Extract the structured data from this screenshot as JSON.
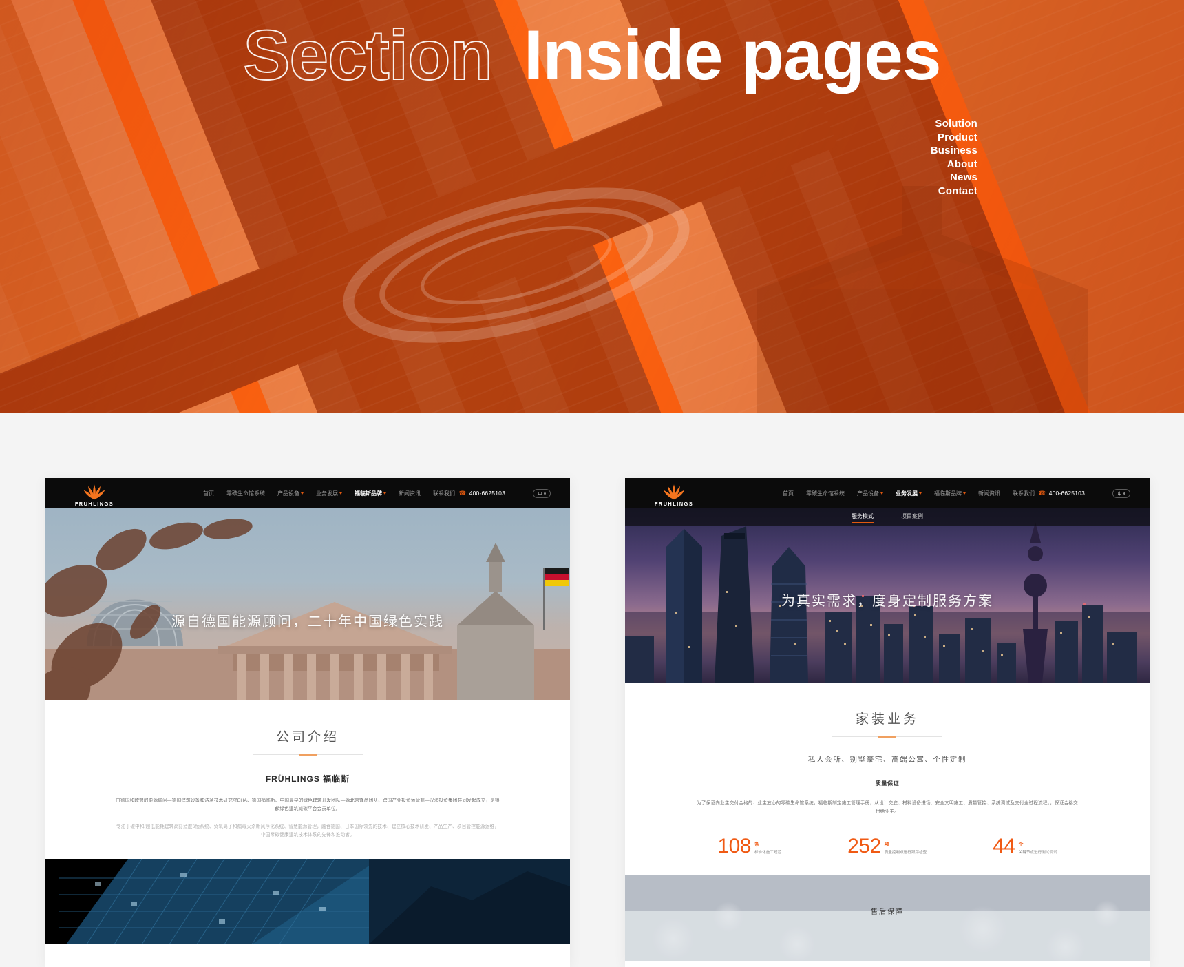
{
  "hero": {
    "title_outline": "Section",
    "title_solid": "Inside pages",
    "nav": [
      {
        "label": "Solution"
      },
      {
        "label": "Product"
      },
      {
        "label": "Business"
      },
      {
        "label": "About"
      },
      {
        "label": "News"
      },
      {
        "label": "Contact"
      }
    ],
    "colors": {
      "orange_vivid": "#ff6a12",
      "orange_mid": "#e0702b",
      "orange_light": "#f08b4d",
      "orange_dark": "#b44410"
    }
  },
  "site_header": {
    "logo_text": "FRUHLINGS",
    "nav": [
      {
        "label": "首页",
        "caret": false,
        "active": false
      },
      {
        "label": "零碳生命馆系统",
        "caret": false,
        "active": false
      },
      {
        "label": "产品设备",
        "caret": true,
        "active": false
      },
      {
        "label": "业务发展",
        "caret": true,
        "active": false
      },
      {
        "label": "福临斯品牌",
        "caret": true,
        "active": true
      },
      {
        "label": "新闻资讯",
        "caret": false,
        "active": false
      },
      {
        "label": "联系我们",
        "caret": false,
        "active": false
      }
    ],
    "nav_right": [
      {
        "label": "首页",
        "caret": false,
        "active": false
      },
      {
        "label": "零碳生命馆系统",
        "caret": false,
        "active": false
      },
      {
        "label": "产品设备",
        "caret": true,
        "active": false
      },
      {
        "label": "业务发展",
        "caret": true,
        "active": true
      },
      {
        "label": "福临斯品牌",
        "caret": true,
        "active": false
      },
      {
        "label": "新闻资讯",
        "caret": false,
        "active": false
      },
      {
        "label": "联系我们",
        "caret": false,
        "active": false
      }
    ],
    "phone": "400-6625103",
    "phone_icon": "phone-icon",
    "lang_label": "中"
  },
  "left_page": {
    "banner_caption": "源自德国能源顾问，二十年中国绿色实践",
    "section_title": "公司介绍",
    "sub_title": "FRÜHLINGS  福临斯",
    "paragraph_1": "由德国和欧盟的能源顾问—德国建筑设备和洁净技术研究院EHA、德国福临斯、中国最早的绿色建筑开发团队—源北京锋尚团队、跨国产业投资运营商—汉海投资集团共同发起成立，是银麟绿色建筑减碳平台会员单位。",
    "paragraph_2": "专注于碳中和/超低能耗建筑高舒适度6恒系统、负氧离子和病毒灭杀新风净化系统、智慧能源管理，融合德国、日本国际领先的技术、建立核心技术研发、产品生产、项目管控能源运维，中国零碳健康建筑技术体系的先锋和推动者。"
  },
  "right_page": {
    "sub_nav": [
      {
        "label": "服务模式",
        "active": true
      },
      {
        "label": "项目案例",
        "active": false
      }
    ],
    "banner_caption": "为真实需求，度身定制服务方案",
    "section_title": "家装业务",
    "lead": "私人会所、别墅豪宅、高端公寓、个性定制",
    "mini_head": "质量保证",
    "paragraph": "为了保证向业主交付合格的、业主放心的零碳生命馆系统，福临斯制定施工管理手册，从设计交底、材料设备进场、安全文明施工、质量管控、系统调试及交付全过程流程，，保证合格交付给业主。",
    "stats": [
      {
        "number": "108",
        "unit": "条",
        "label": "标准化施工规范"
      },
      {
        "number": "252",
        "unit": "项",
        "label": "质量控制点进行跟踪检查"
      },
      {
        "number": "44",
        "unit": "个",
        "label": "关键节点进行测试调试"
      }
    ],
    "strip_caption": "售后保障"
  }
}
